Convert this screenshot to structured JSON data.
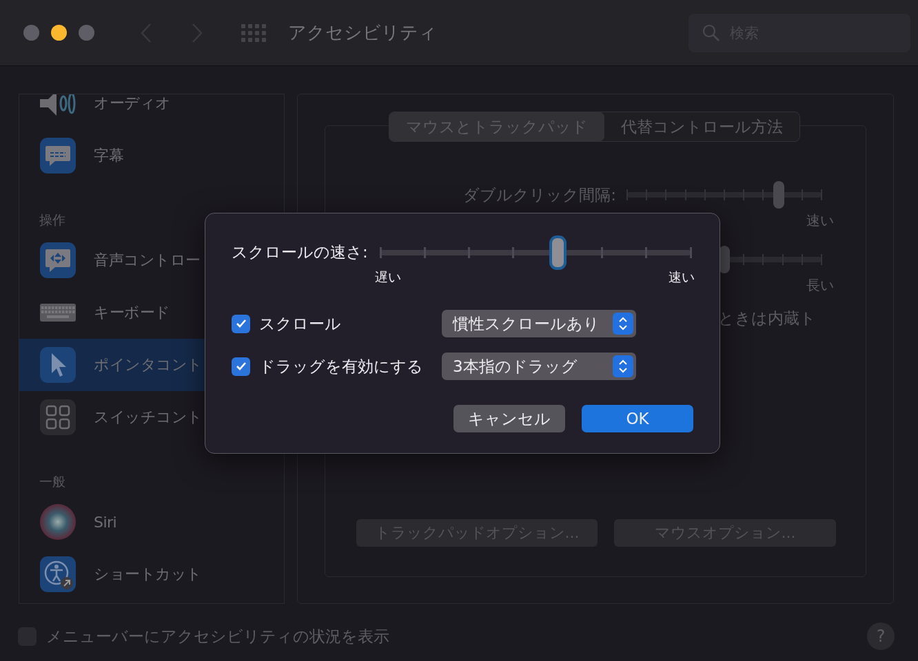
{
  "window": {
    "title": "アクセシビリティ"
  },
  "search": {
    "placeholder": "検索"
  },
  "sidebar": [
    {
      "kind": "item",
      "label": "オーディオ",
      "selected": false
    },
    {
      "kind": "item",
      "label": "字幕",
      "selected": false
    },
    {
      "kind": "header",
      "label": "操作"
    },
    {
      "kind": "item",
      "label": "音声コントロー",
      "selected": false
    },
    {
      "kind": "item",
      "label": "キーボード",
      "selected": false
    },
    {
      "kind": "item",
      "label": "ポインタコント",
      "selected": true
    },
    {
      "kind": "item",
      "label": "スイッチコント",
      "selected": false
    },
    {
      "kind": "header",
      "label": "一般"
    },
    {
      "kind": "item",
      "label": "Siri",
      "selected": false
    },
    {
      "kind": "item",
      "label": "ショートカット",
      "selected": false
    }
  ],
  "tabs": [
    {
      "label": "マウスとトラックパッド",
      "selected": true
    },
    {
      "label": "代替コントロール方法",
      "selected": false
    }
  ],
  "panel": {
    "double_click": {
      "label": "ダブルクリック間隔:",
      "level": 0.78,
      "end_label": "速い"
    },
    "second_slider": {
      "level": 0.5,
      "end_label": "長い"
    },
    "partial_text": "ときは内蔵ト",
    "buttons": [
      "トラックパッドオプション...",
      "マウスオプション..."
    ]
  },
  "dialog": {
    "scroll_speed": {
      "label": "スクロールの速さ:",
      "level": 0.571,
      "min_label": "遅い",
      "max_label": "速い"
    },
    "options": [
      {
        "label": "スクロール",
        "checked": true,
        "popup": "慣性スクロールあり"
      },
      {
        "label": "ドラッグを有効にする",
        "checked": true,
        "popup": "3本指のドラッグ"
      }
    ],
    "cancel": "キャンセル",
    "ok": "OK"
  },
  "footer": {
    "label": "メニューバーにアクセシビリティの状況を表示",
    "checked": false,
    "help": "?"
  }
}
